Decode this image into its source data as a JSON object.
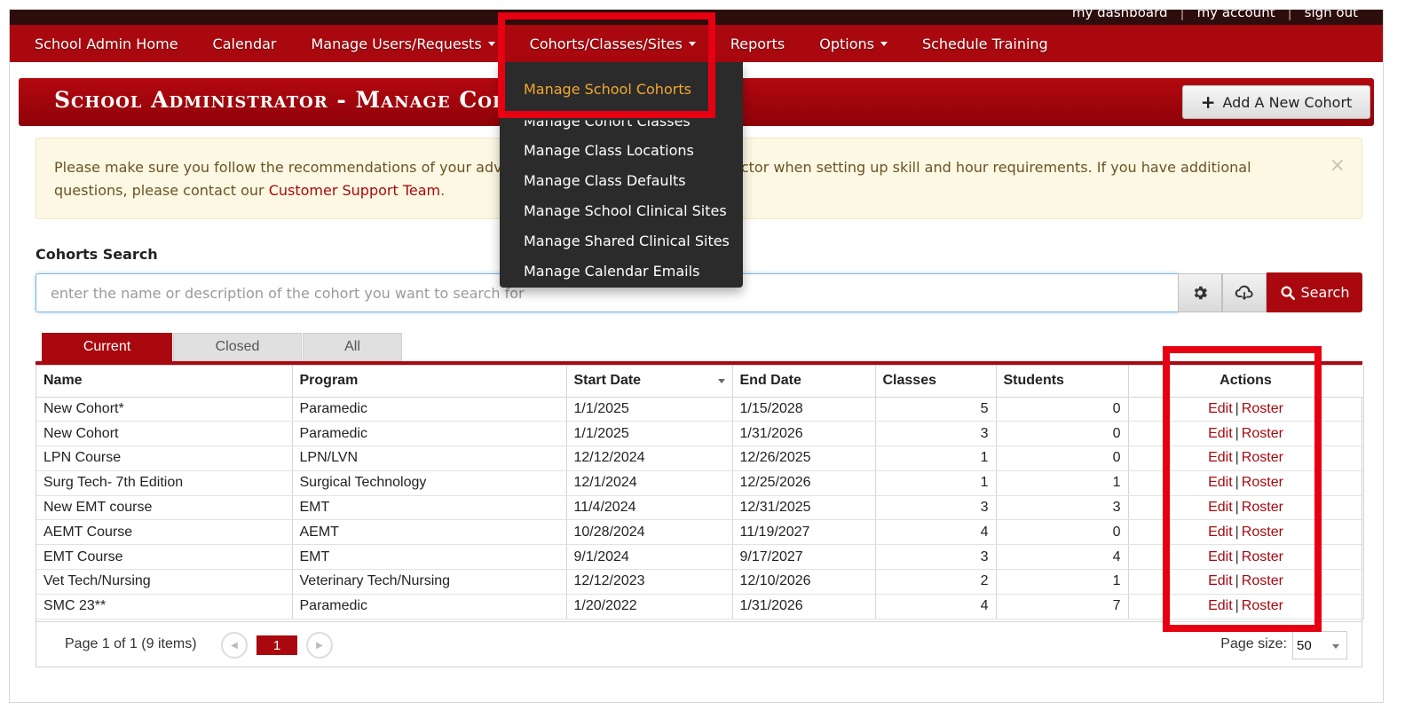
{
  "utility_links": [
    "my dashboard",
    "|",
    "my account",
    "|",
    "sign out"
  ],
  "nav": {
    "items": [
      {
        "label": "School Admin Home",
        "caret": false
      },
      {
        "label": "Calendar",
        "caret": false
      },
      {
        "label": "Manage Users/Requests",
        "caret": true
      },
      {
        "label": "Cohorts/Classes/Sites",
        "caret": true
      },
      {
        "label": "Reports",
        "caret": false
      },
      {
        "label": "Options",
        "caret": true
      },
      {
        "label": "Schedule Training",
        "caret": false
      }
    ]
  },
  "dropdown": {
    "items": [
      "Manage School Cohorts",
      "Manage Cohort Classes",
      "Manage Class Locations",
      "Manage Class Defaults",
      "Manage School Clinical Sites",
      "Manage Shared Clinical Sites",
      "Manage Calendar Emails"
    ],
    "active_index": 0
  },
  "header": {
    "title": "School Administrator - Manage Cohorts",
    "add_button": "Add A New Cohort"
  },
  "alert": {
    "text_before": "Please make sure you follow the recommendations of your advisory committee and medical director when setting up skill and hour requirements. If you have additional questions, please contact our ",
    "link": "Customer Support Team",
    "text_after": ".",
    "close": "×"
  },
  "search": {
    "label": "Cohorts Search",
    "placeholder": "enter the name or description of the cohort you want to search for",
    "button": "Search"
  },
  "tabs": [
    "Current",
    "Closed",
    "All"
  ],
  "table": {
    "columns": [
      "Name",
      "Program",
      "Start Date",
      "End Date",
      "Classes",
      "Students",
      "Actions"
    ],
    "rows": [
      {
        "name": "New Cohort*",
        "program": "Paramedic",
        "start": "1/1/2025",
        "end": "1/15/2028",
        "classes": "5",
        "students": "0"
      },
      {
        "name": "New Cohort",
        "program": "Paramedic",
        "start": "1/1/2025",
        "end": "1/31/2026",
        "classes": "3",
        "students": "0"
      },
      {
        "name": "LPN Course",
        "program": "LPN/LVN",
        "start": "12/12/2024",
        "end": "12/26/2025",
        "classes": "1",
        "students": "0"
      },
      {
        "name": "Surg Tech- 7th Edition",
        "program": "Surgical Technology",
        "start": "12/1/2024",
        "end": "12/25/2026",
        "classes": "1",
        "students": "1"
      },
      {
        "name": "New EMT course",
        "program": "EMT",
        "start": "11/4/2024",
        "end": "12/31/2025",
        "classes": "3",
        "students": "3"
      },
      {
        "name": "AEMT Course",
        "program": "AEMT",
        "start": "10/28/2024",
        "end": "11/19/2027",
        "classes": "4",
        "students": "0"
      },
      {
        "name": "EMT Course",
        "program": "EMT",
        "start": "9/1/2024",
        "end": "9/17/2027",
        "classes": "3",
        "students": "4"
      },
      {
        "name": "Vet Tech/Nursing",
        "program": "Veterinary Tech/Nursing",
        "start": "12/12/2023",
        "end": "12/10/2026",
        "classes": "2",
        "students": "1"
      },
      {
        "name": "SMC 23**",
        "program": "Paramedic",
        "start": "1/20/2022",
        "end": "1/31/2026",
        "classes": "4",
        "students": "7"
      }
    ],
    "action_edit": "Edit",
    "action_sep": "|",
    "action_roster": "Roster"
  },
  "pager": {
    "info": "Page 1 of 1 (9 items)",
    "current_page": "1",
    "page_size_label": "Page size:",
    "page_size": "50"
  },
  "colors": {
    "brand_red": "#a8080e",
    "annotation_red": "#e60012",
    "dropdown_active": "#f0a830",
    "dropdown_bg": "#2b2b2b"
  }
}
